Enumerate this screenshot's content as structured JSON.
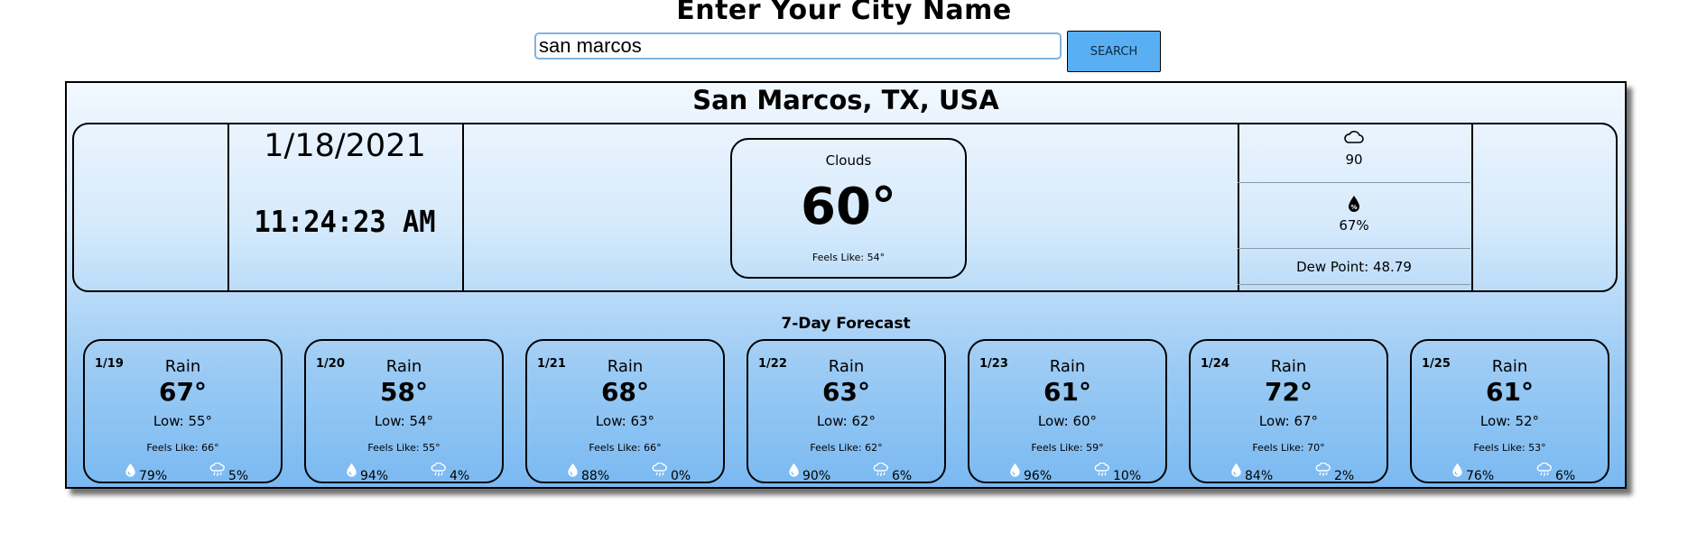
{
  "search": {
    "title": "Enter Your City Name",
    "value": "san marcos",
    "button_label": "SEARCH"
  },
  "current": {
    "location": "San Marcos, TX, USA",
    "date": "1/18/2021",
    "time": "11:24:23 AM",
    "condition": "Clouds",
    "temp": "60°",
    "feels_like": "Feels Like: 54°",
    "cloud_icon": "cloud-icon",
    "cloudiness": "90",
    "humidity_icon": "humidity-percent-icon",
    "humidity": "67%",
    "dew_point": "Dew Point: 48.79"
  },
  "forecast": {
    "title": "7-Day Forecast",
    "days": [
      {
        "date": "1/19",
        "condition": "Rain",
        "high": "67°",
        "low": "Low: 55°",
        "feels": "Feels Like: 66°",
        "humidity": "79%",
        "precip": "5%"
      },
      {
        "date": "1/20",
        "condition": "Rain",
        "high": "58°",
        "low": "Low: 54°",
        "feels": "Feels Like: 55°",
        "humidity": "94%",
        "precip": "4%"
      },
      {
        "date": "1/21",
        "condition": "Rain",
        "high": "68°",
        "low": "Low: 63°",
        "feels": "Feels Like: 66°",
        "humidity": "88%",
        "precip": "0%"
      },
      {
        "date": "1/22",
        "condition": "Rain",
        "high": "63°",
        "low": "Low: 62°",
        "feels": "Feels Like: 62°",
        "humidity": "90%",
        "precip": "6%"
      },
      {
        "date": "1/23",
        "condition": "Rain",
        "high": "61°",
        "low": "Low: 60°",
        "feels": "Feels Like: 59°",
        "humidity": "96%",
        "precip": "10%"
      },
      {
        "date": "1/24",
        "condition": "Rain",
        "high": "72°",
        "low": "Low: 67°",
        "feels": "Feels Like: 70°",
        "humidity": "84%",
        "precip": "2%"
      },
      {
        "date": "1/25",
        "condition": "Rain",
        "high": "61°",
        "low": "Low: 52°",
        "feels": "Feels Like: 53°",
        "humidity": "76%",
        "precip": "6%"
      }
    ]
  },
  "colors": {
    "panel_top": "#f2f8fe",
    "panel_bottom": "#7ab9f1",
    "button": "#5aaff2",
    "input_border": "#7eb3df"
  }
}
